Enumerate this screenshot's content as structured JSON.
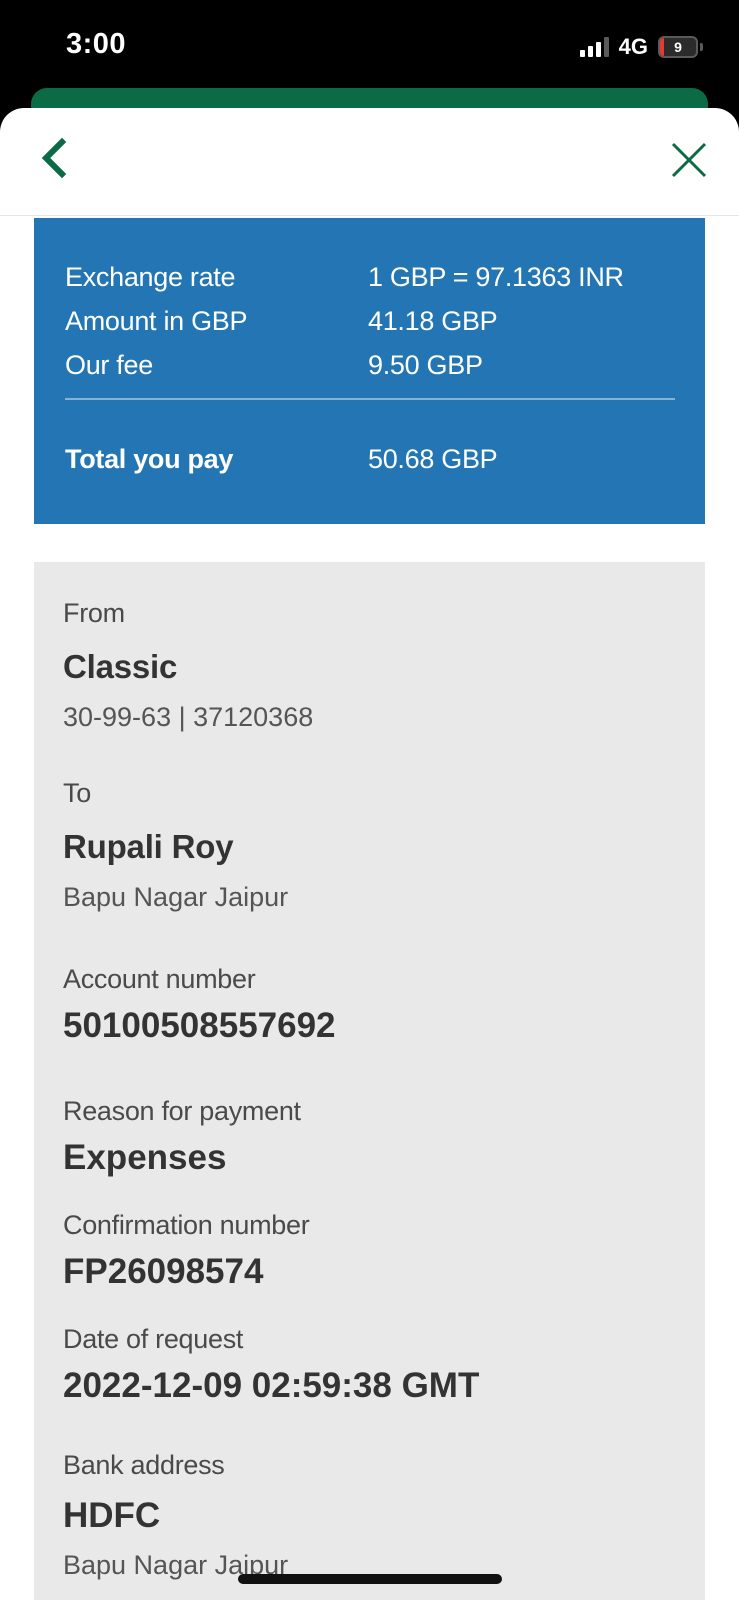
{
  "status_bar": {
    "time": "3:00",
    "network": "4G",
    "battery": "9"
  },
  "colors": {
    "brand_green": "#0a6b46",
    "rate_box_blue": "#2376b3",
    "details_bg": "#e9e9e9"
  },
  "header": {
    "back_icon": "chevron-left-icon",
    "close_icon": "close-icon"
  },
  "rate_summary": {
    "exchange_rate_label": "Exchange rate",
    "exchange_rate_value": "1 GBP = 97.1363 INR",
    "amount_label": "Amount in GBP",
    "amount_value": "41.18 GBP",
    "fee_label": "Our fee",
    "fee_value": "9.50 GBP",
    "total_label": "Total you pay",
    "total_value": "50.68 GBP"
  },
  "details": {
    "from_label": "From",
    "from_account_name": "Classic",
    "from_account_details": "30-99-63 | 37120368",
    "to_label": "To",
    "to_name": "Rupali Roy",
    "to_address": "Bapu Nagar Jaipur",
    "account_number_label": "Account number",
    "account_number": "50100508557692",
    "reason_label": "Reason for payment",
    "reason": "Expenses",
    "confirmation_label": "Confirmation number",
    "confirmation_number": "FP26098574",
    "date_label": "Date of request",
    "date_value": "2022-12-09 02:59:38 GMT",
    "bank_address_label": "Bank address",
    "bank_name": "HDFC",
    "bank_address": "Bapu Nagar Jaipur"
  }
}
